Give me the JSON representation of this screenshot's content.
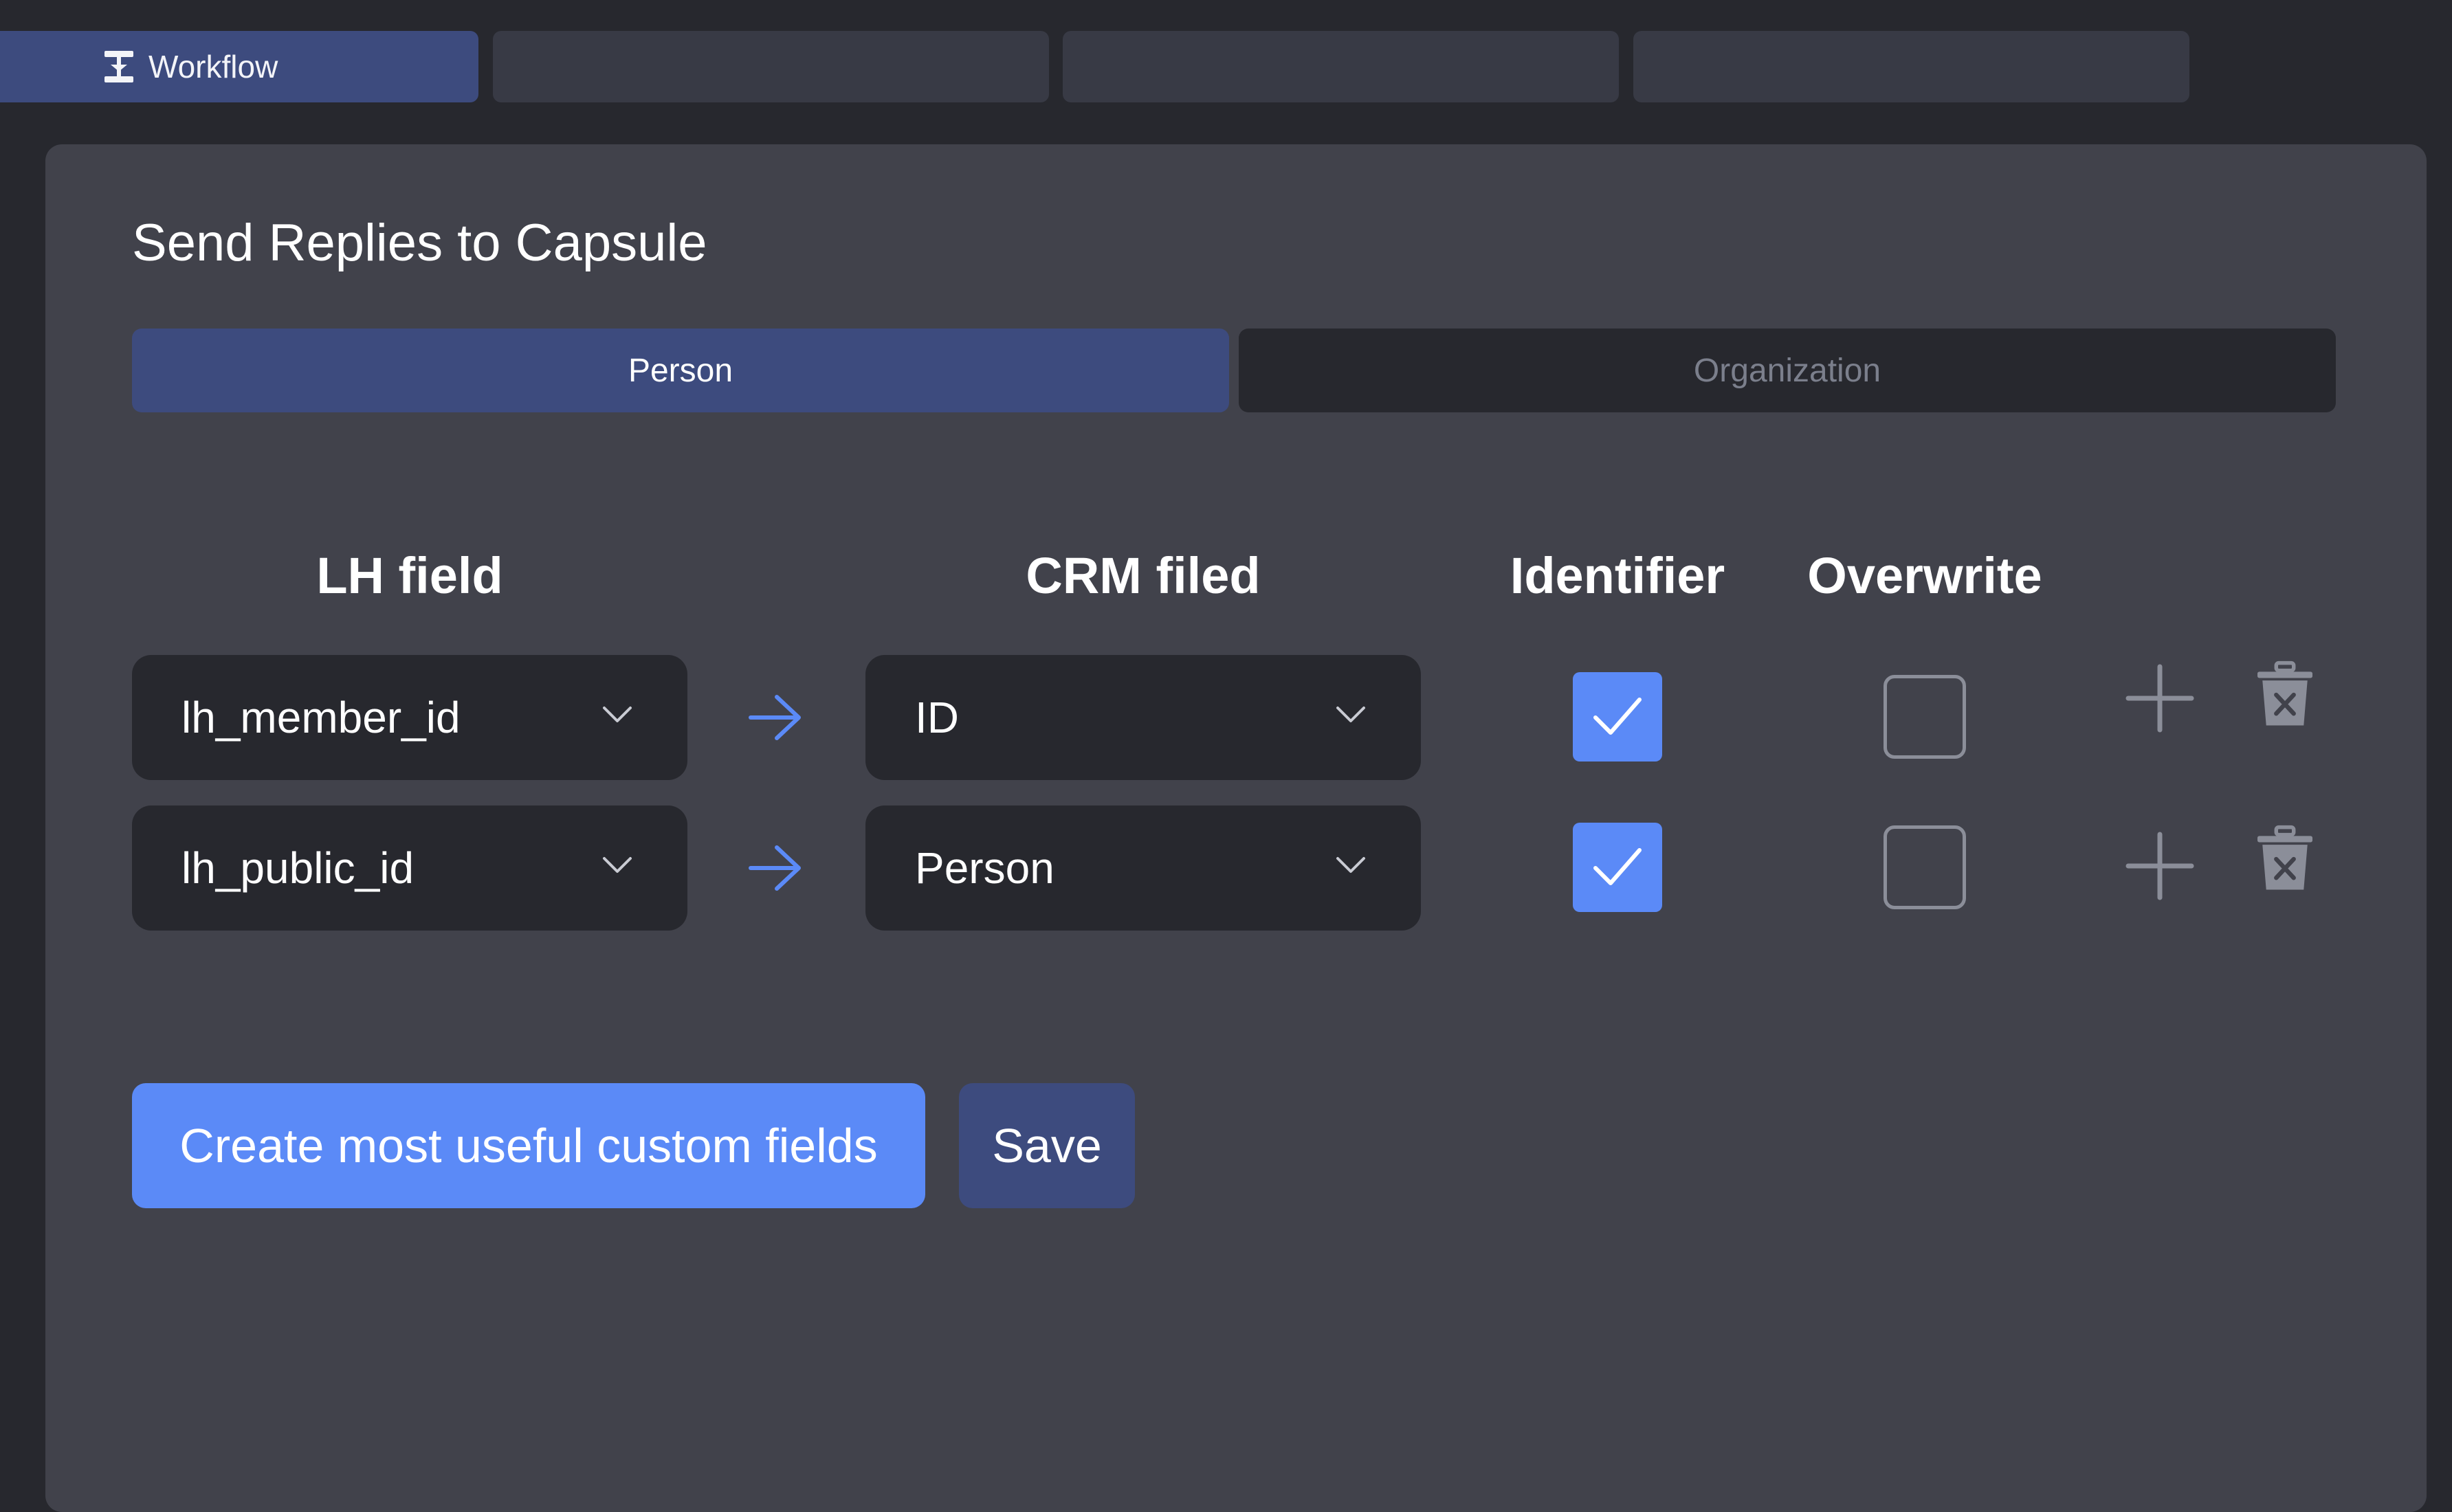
{
  "tabs": [
    {
      "label": "Workflow",
      "icon": "workflow-icon",
      "active": true
    },
    {
      "label": "",
      "active": false
    },
    {
      "label": "",
      "active": false
    },
    {
      "label": "",
      "active": false
    }
  ],
  "panel": {
    "title": "Send Replies to Capsule",
    "segments": {
      "person": "Person",
      "organization": "Organization",
      "selected": "Person"
    },
    "headers": {
      "lh_field": "LH field",
      "crm_field": "CRM filed",
      "identifier": "Identifier",
      "overwrite": "Overwrite"
    },
    "rows": [
      {
        "lh_field": "lh_member_id",
        "crm_field": "ID",
        "identifier": true,
        "overwrite": false
      },
      {
        "lh_field": "lh_public_id",
        "crm_field": "Person",
        "identifier": true,
        "overwrite": false
      }
    ],
    "buttons": {
      "create_fields": "Create most useful custom fields",
      "save": "Save"
    }
  },
  "colors": {
    "accent": "#5b8af7",
    "active_tab": "#3d4b7e",
    "panel_bg": "#41424b",
    "page_bg": "#27282e",
    "field_bg": "#27282e"
  }
}
